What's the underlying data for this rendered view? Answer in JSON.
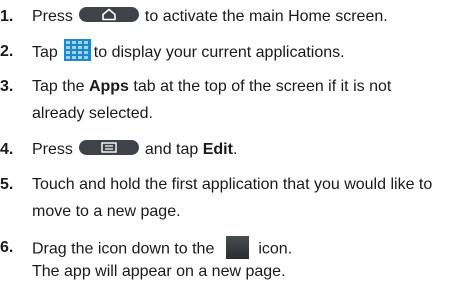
{
  "steps": [
    {
      "number": "1.",
      "before": "Press",
      "icon": "home-key-icon",
      "after": "to activate the main Home screen."
    },
    {
      "number": "2.",
      "before": "Tap",
      "icon": "apps-grid-icon",
      "after": "to display your current applications."
    },
    {
      "number": "3.",
      "before": "Tap the ",
      "bold": "Apps",
      "after": " tab at the top of the screen if it is not",
      "continuation": "already selected."
    },
    {
      "number": "4.",
      "before": "Press",
      "icon": "menu-key-icon",
      "after": "and tap ",
      "bold_end": "Edit",
      "tail": "."
    },
    {
      "number": "5.",
      "text": "Touch and hold the first application that you would like to",
      "continuation": "move to a new page."
    },
    {
      "number": "6.",
      "before": "Drag the icon down to the",
      "icon": "new-page-icon",
      "after": "icon.",
      "continuation": "The app will appear on a new page."
    }
  ],
  "colors": {
    "text": "#1a1a1a",
    "key_background": "#3f4347",
    "apps_icon": "#1e88c8"
  }
}
